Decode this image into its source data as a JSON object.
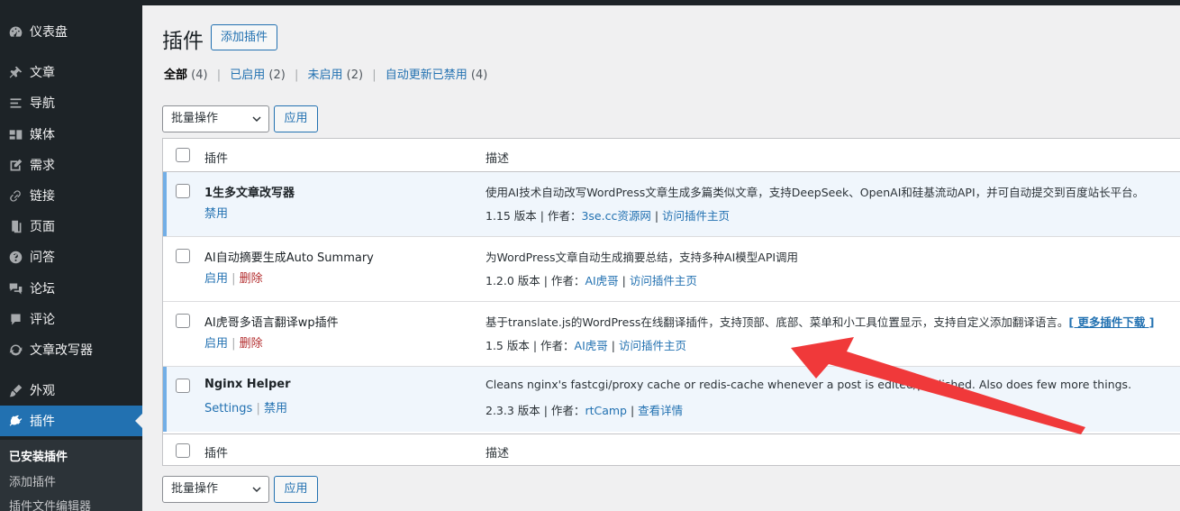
{
  "sidebar": {
    "items": [
      {
        "label": "仪表盘",
        "icon": "dashboard-icon"
      },
      {
        "label": "文章",
        "icon": "pin-icon"
      },
      {
        "label": "导航",
        "icon": "menu-lines-icon"
      },
      {
        "label": "媒体",
        "icon": "media-icon"
      },
      {
        "label": "需求",
        "icon": "edit-icon"
      },
      {
        "label": "链接",
        "icon": "link-icon"
      },
      {
        "label": "页面",
        "icon": "page-icon"
      },
      {
        "label": "问答",
        "icon": "question-icon"
      },
      {
        "label": "论坛",
        "icon": "forum-icon"
      },
      {
        "label": "评论",
        "icon": "comment-icon"
      },
      {
        "label": "文章改写器",
        "icon": "refresh-icon"
      },
      {
        "label": "外观",
        "icon": "brush-icon"
      },
      {
        "label": "插件",
        "icon": "plugin-icon"
      }
    ],
    "submenu": [
      "已安装插件",
      "添加插件",
      "插件文件编辑器"
    ]
  },
  "header": {
    "title": "插件",
    "add_new": "添加插件"
  },
  "filters": [
    {
      "label": "全部",
      "count": "(4)"
    },
    {
      "label": "已启用",
      "count": "(2)"
    },
    {
      "label": "未启用",
      "count": "(2)"
    },
    {
      "label": "自动更新已禁用",
      "count": "(4)"
    }
  ],
  "bulk": {
    "label": "批量操作",
    "apply": "应用"
  },
  "table": {
    "col_plugin": "插件",
    "col_desc": "描述",
    "rows": [
      {
        "name": "1生多文章改写器",
        "action1": "禁用",
        "desc": "使用AI技术自动改写WordPress文章生成多篇类似文章，支持DeepSeek、OpenAI和硅基流动API，并可自动提交到百度站长平台。",
        "version": "1.15 版本 | 作者：",
        "author": "3se.cc资源网",
        "link": "访问插件主页"
      },
      {
        "name": "AI自动摘要生成Auto Summary",
        "action1": "启用",
        "action2": "删除",
        "desc": "为WordPress文章自动生成摘要总结，支持多种AI模型API调用",
        "version": "1.2.0 版本 | 作者：",
        "author": "AI虎哥",
        "link": "访问插件主页"
      },
      {
        "name": "AI虎哥多语言翻译wp插件",
        "action1": "启用",
        "action2": "删除",
        "desc": "基于translate.js的WordPress在线翻译插件，支持顶部、底部、菜单和小工具位置显示，支持自定义添加翻译语言。",
        "more": "[ 更多插件下载 ]",
        "version": "1.5 版本 | 作者：",
        "author": "AI虎哥",
        "link": "访问插件主页"
      },
      {
        "name": "Nginx Helper",
        "action1": "Settings",
        "action2": "禁用",
        "desc": "Cleans nginx's fastcgi/proxy cache or redis-cache whenever a post is edited/published. Also does few more things.",
        "version": "2.3.3 版本 | 作者：",
        "author": "rtCamp",
        "link": "查看详情"
      }
    ]
  },
  "colors": {
    "sidebar": "#1d2327",
    "accent": "#2271b1",
    "arrow": "#f0393a"
  }
}
